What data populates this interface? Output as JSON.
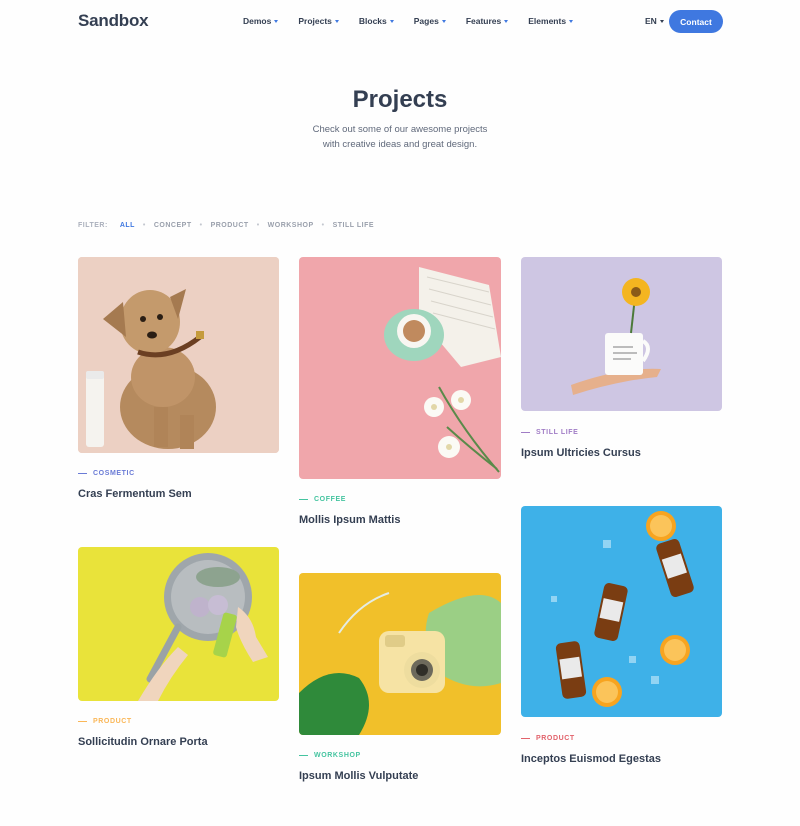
{
  "brand": {
    "logo": "Sandbox"
  },
  "nav": {
    "items": [
      "Demos",
      "Projects",
      "Blocks",
      "Pages",
      "Features",
      "Elements"
    ],
    "lang": "EN",
    "contact": "Contact"
  },
  "hero": {
    "title": "Projects",
    "subtitle_line1": "Check out some of our awesome projects",
    "subtitle_line2": "with creative ideas and great design."
  },
  "filter": {
    "label": "Filter:",
    "options": [
      "All",
      "Concept",
      "Product",
      "Workshop",
      "Still Life"
    ],
    "active": "All"
  },
  "projects": [
    {
      "category": "Cosmetic",
      "title": "Cras Fermentum Sem",
      "color": "#6a7bd6"
    },
    {
      "category": "Coffee",
      "title": "Mollis Ipsum Mattis",
      "color": "#45c4a0"
    },
    {
      "category": "Still Life",
      "title": "Ipsum Ultricies Cursus",
      "color": "#a07cc5"
    },
    {
      "category": "Product",
      "title": "Sollicitudin Ornare Porta",
      "color": "#fab758"
    },
    {
      "category": "Workshop",
      "title": "Ipsum Mollis Vulputate",
      "color": "#45c4a0"
    },
    {
      "category": "Product",
      "title": "Inceptos Euismod Egestas",
      "color": "#e2626b"
    }
  ],
  "colors": {
    "primary": "#3f78e0",
    "heading": "#343f52",
    "body": "#60697b"
  }
}
